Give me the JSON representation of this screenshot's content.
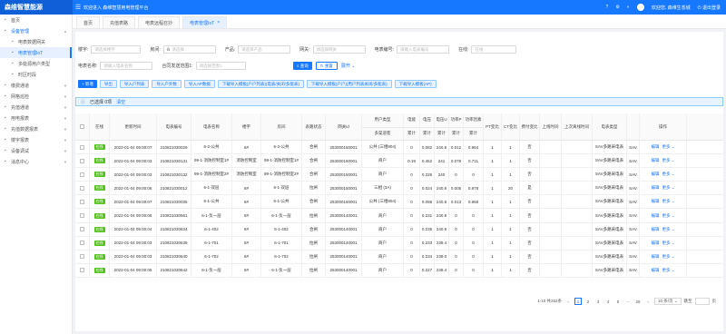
{
  "header": {
    "logo": "森维智慧能源",
    "menu_icon": "menu-fold-icon",
    "welcome": "欢迎进入 森维智慧用电管理平台",
    "user": "欢迎您, 森维生态城",
    "logout": "退出登录"
  },
  "sidebar": [
    {
      "label": "首页",
      "icon": "home-icon",
      "sub": false,
      "open": false,
      "active": false,
      "arrow": false
    },
    {
      "label": "设备管理",
      "icon": "device-icon",
      "sub": false,
      "open": true,
      "active": false,
      "arrow": true,
      "arrow_dir": "up"
    },
    {
      "label": "电表数据网关",
      "icon": "gateway-icon",
      "sub": true,
      "open": false,
      "active": false,
      "arrow": false
    },
    {
      "label": "电表管理IoT",
      "icon": "meter-icon",
      "sub": true,
      "open": false,
      "active": true,
      "arrow": false
    },
    {
      "label": "多能源用户类型",
      "icon": "energy-icon",
      "sub": true,
      "open": false,
      "active": false,
      "arrow": false
    },
    {
      "label": "时区时段",
      "icon": "clock-icon",
      "sub": true,
      "open": false,
      "active": false,
      "arrow": false
    },
    {
      "label": "缴费通道",
      "icon": "pay-icon",
      "sub": false,
      "open": false,
      "active": false,
      "arrow": true,
      "arrow_dir": "down"
    },
    {
      "label": "网格巡检",
      "icon": "grid-icon",
      "sub": false,
      "open": false,
      "active": false,
      "arrow": true,
      "arrow_dir": "down"
    },
    {
      "label": "充值通道",
      "icon": "charge-icon",
      "sub": false,
      "open": false,
      "active": false,
      "arrow": true,
      "arrow_dir": "down"
    },
    {
      "label": "用电报表",
      "icon": "report-icon",
      "sub": false,
      "open": false,
      "active": false,
      "arrow": true,
      "arrow_dir": "down"
    },
    {
      "label": "充值数据报表",
      "icon": "data-icon",
      "sub": false,
      "open": false,
      "active": false,
      "arrow": true,
      "arrow_dir": "down"
    },
    {
      "label": "楼宇报表",
      "icon": "building-icon",
      "sub": false,
      "open": false,
      "active": false,
      "arrow": true,
      "arrow_dir": "down"
    },
    {
      "label": "设备调试",
      "icon": "debug-icon",
      "sub": false,
      "open": false,
      "active": false,
      "arrow": true,
      "arrow_dir": "down"
    },
    {
      "label": "消息中心",
      "icon": "message-icon",
      "sub": false,
      "open": false,
      "active": false,
      "arrow": true,
      "arrow_dir": "down"
    }
  ],
  "tabs": [
    {
      "label": "首页",
      "active": false
    },
    {
      "label": "充值表路",
      "active": false
    },
    {
      "label": "电表远程召抄",
      "active": false
    },
    {
      "label": "电表管理IoT",
      "active": true,
      "close": "×"
    }
  ],
  "filters": {
    "row1": [
      {
        "label": "楼宇:",
        "ph": "请选择楼宇",
        "w": 55
      },
      {
        "label": "房间:",
        "ph": "请选择",
        "w": 58,
        "prefix": "ℝ"
      },
      {
        "label": "产品:",
        "ph": "请选择产品",
        "w": 58
      },
      {
        "label": "网关:",
        "ph": "请选择网关",
        "w": 58
      },
      {
        "label": "电表编号:",
        "ph": "请输入电表编号",
        "w": 58
      },
      {
        "label": "在线:",
        "ph": "在线",
        "w": 50
      }
    ],
    "row2": [
      {
        "label": "电表名称:",
        "ph": "请输入电表名称",
        "w": 58
      },
      {
        "label": "合同发送范围1:",
        "ph": "请选择范围1",
        "w": 55
      }
    ],
    "search": "查询",
    "reset": "重置",
    "expand": "展开"
  },
  "actions": [
    "+ 新增",
    "导出",
    "导入户列表",
    "导入户外数",
    "导入AP数据",
    "下载导入模板(户户列表)(电表/关闭/多能表)",
    "下载导入模板(户户)(用户列表关闭/多能表)",
    "下载导入模板(AP)"
  ],
  "selection": {
    "text": "已选择 0项",
    "clear": "清空"
  },
  "columns": [
    {
      "label": "在线",
      "w": 22
    },
    {
      "label": "更新时间",
      "w": 52
    },
    {
      "label": "电表编号",
      "w": 38
    },
    {
      "label": "电表名称",
      "w": 45
    },
    {
      "label": "楼宇",
      "w": 32
    },
    {
      "label": "房间",
      "w": 45
    },
    {
      "label": "表路状态",
      "w": 26
    },
    {
      "label": "网关id",
      "w": 40
    },
    {
      "label": "用户类型",
      "sub": [
        "",
        "多渠道客"
      ],
      "w": 46
    },
    {
      "label": "电能",
      "sub": [
        "",
        "累计"
      ],
      "w": 18
    },
    {
      "label": "电压",
      "sub": [
        "",
        "累计"
      ],
      "w": 16
    },
    {
      "label": "电压U",
      "sub": [
        "",
        "累计"
      ],
      "w": 16
    },
    {
      "label": "功率P",
      "sub": [
        "",
        "累计"
      ],
      "w": 16
    },
    {
      "label": "功率因素",
      "sub": [
        "",
        "累计"
      ],
      "w": 22
    },
    {
      "label": "PT变比",
      "w": 20
    },
    {
      "label": "CT变比",
      "w": 20
    },
    {
      "label": "费付变比",
      "w": 22
    },
    {
      "label": "上线时间",
      "w": 24
    },
    {
      "label": "上次离线时间",
      "w": 34
    },
    {
      "label": "电表类型",
      "w": 38
    },
    {
      "label": "",
      "w": 14
    },
    {
      "label": "操作",
      "w": 52
    }
  ],
  "rows": [
    [
      "在线",
      "2022-01-04 09:00:07",
      "210821030029",
      "6-2-公共",
      "6#",
      "6-2-公共",
      "合闸",
      "253000150001",
      "公共 (三相804)",
      "0",
      "0.082",
      "240.8",
      "0.012",
      "0.964",
      "1",
      "1",
      "否",
      "",
      "",
      "SAV多路采电表",
      "SAV"
    ],
    [
      "在线",
      "2022-01-04 09:00:03",
      "210821030131",
      "99-1-消防控制室1#",
      "消防控制室",
      "99-1-消防控制室1#",
      "合闸",
      "253000150001",
      "商户",
      "0.19",
      "0.452",
      "241",
      "0.078",
      "0.711",
      "1",
      "1",
      "否",
      "",
      "",
      "SAV多路采电表",
      "SAV"
    ],
    [
      "在线",
      "2022-01-04 09:00:03",
      "210821030132",
      "99-1-消防控制室2#",
      "消防控制室",
      "99-1-消防控制室2#",
      "合闸",
      "253000150001",
      "商户",
      "0",
      "0.226",
      "240",
      "0",
      "0",
      "1",
      "1",
      "否",
      "",
      "",
      "SAV多路采电表",
      "SAV"
    ],
    [
      "在线",
      "2022-01-04 09:00:06",
      "210821030012",
      "6-1-双层",
      "6#",
      "6-1-双层",
      "拉闸",
      "253000150001",
      "三相 (3A)",
      "0",
      "0.024",
      "240.9",
      "0.005",
      "0.978",
      "1",
      "20",
      "是",
      "",
      "",
      "SAV多路采电表",
      "SAV"
    ],
    [
      "在线",
      "2022-01-04 09:00:07",
      "210821030035",
      "6-1-公共",
      "6#",
      "6-1-公共",
      "合闸",
      "253000150001",
      "公共 (三相804)",
      "0",
      "0.096",
      "240.8",
      "0.013",
      "0.968",
      "1",
      "1",
      "否",
      "",
      "",
      "SAV多路采电表",
      "SAV"
    ],
    [
      "在线",
      "2022-01-04 09:00:06",
      "210821030561",
      "6-1-负一层",
      "6#",
      "6-1-负一层",
      "拉闸",
      "253000140001",
      "商户",
      "0",
      "0.231",
      "240.8",
      "0",
      "0",
      "1",
      "1",
      "否",
      "",
      "",
      "SAV多路采电表",
      "SAV"
    ],
    [
      "在线",
      "2022-01-04 09:00:04",
      "210821030634",
      "6-1-402",
      "6#",
      "6-1-402",
      "合闸",
      "253000140001",
      "商户",
      "0",
      "0.235",
      "240.9",
      "0",
      "0",
      "1",
      "1",
      "否",
      "",
      "",
      "SAV多路采电表",
      "SAV"
    ],
    [
      "在线",
      "2022-01-04 09:00:03",
      "210821030639",
      "6-1-701",
      "6#",
      "6-1-701",
      "拉闸",
      "253000140001",
      "商户",
      "0",
      "0.233",
      "239.4",
      "0",
      "0",
      "1",
      "1",
      "否",
      "",
      "",
      "SAV多路采电表",
      "SAV"
    ],
    [
      "在线",
      "2022-01-04 09:00:03",
      "210821030640",
      "6-1-702",
      "6#",
      "6-1-702",
      "拉闸",
      "253000140001",
      "商户",
      "0",
      "0.234",
      "239.0",
      "0",
      "0",
      "1",
      "1",
      "否",
      "",
      "",
      "SAV多路采电表",
      "SAV"
    ],
    [
      "在线",
      "2022-01-04 09:00:05",
      "210821030642",
      "6-1-负一层",
      "6#",
      "6-1-负一层",
      "拉闸",
      "253000140001",
      "商户",
      "0",
      "0.227",
      "239.4",
      "0",
      "0",
      "1",
      "1",
      "否",
      "",
      "",
      "SAV多路采电表",
      "SAV"
    ]
  ],
  "row_actions": {
    "edit": "编辑",
    "more": "更多"
  },
  "pagination": {
    "total": "1-10 共252条",
    "pages": [
      "1",
      "2",
      "3",
      "4",
      "5",
      "···",
      "26"
    ],
    "current": "1",
    "size": "10 条/页",
    "goto": "跳至",
    "unit": "页"
  }
}
